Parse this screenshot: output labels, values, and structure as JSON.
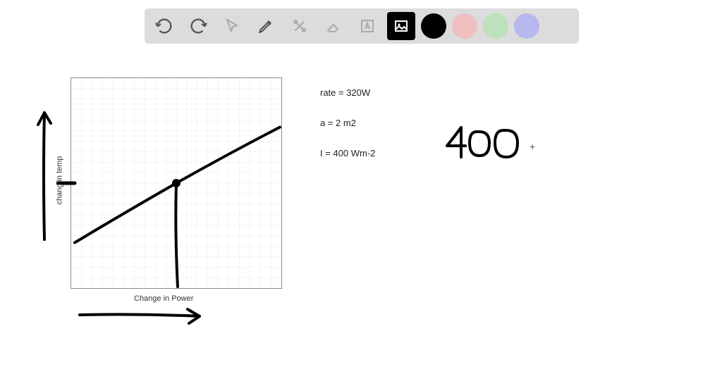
{
  "toolbar": {
    "tools": [
      {
        "name": "undo"
      },
      {
        "name": "redo"
      },
      {
        "name": "cursor"
      },
      {
        "name": "pencil"
      },
      {
        "name": "tools"
      },
      {
        "name": "eraser"
      },
      {
        "name": "text"
      },
      {
        "name": "image"
      }
    ],
    "colors": {
      "black": "#000000",
      "pink": "#f0c0c0",
      "green": "#bde0bd",
      "purple": "#b8b8f0"
    }
  },
  "chart_data": {
    "type": "line",
    "xlabel": "Change in Power",
    "ylabel": "chang in temp",
    "grid": true,
    "annotations": [
      "marked point on line with vertical drop"
    ]
  },
  "notes": {
    "line1": "rate = 320W",
    "line2": "a = 2 m2",
    "line3": "I = 400 Wm-2"
  },
  "handwriting": {
    "value": "400"
  }
}
